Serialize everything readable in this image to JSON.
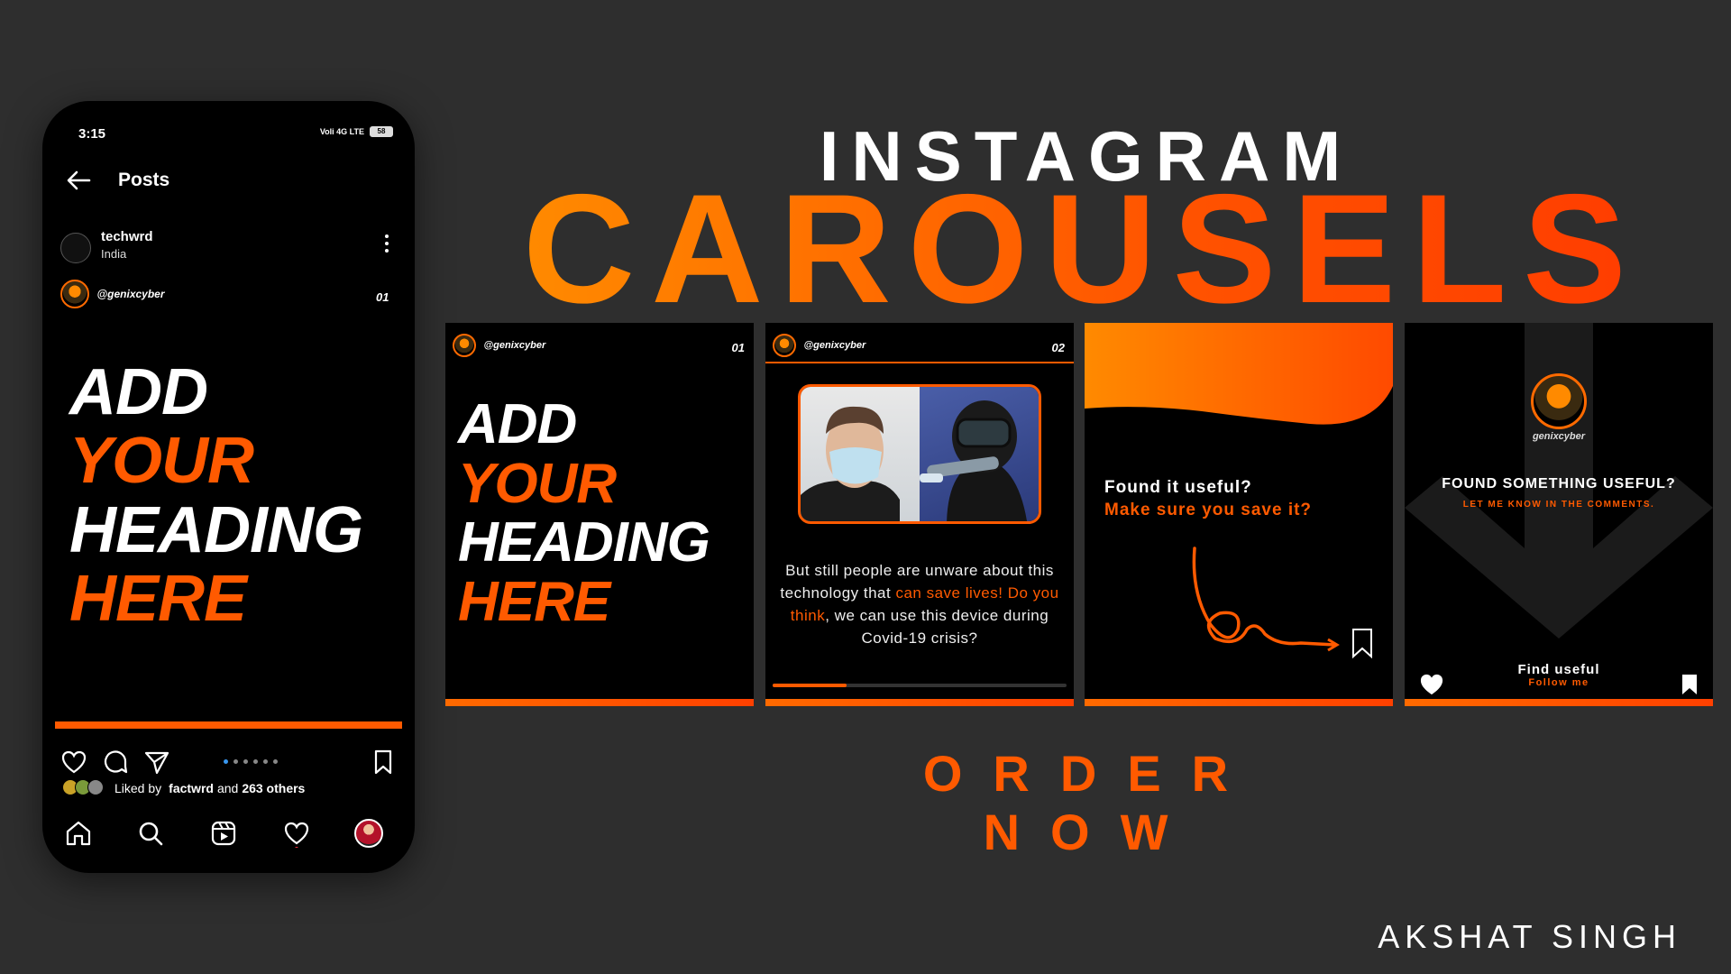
{
  "phone": {
    "time": "3:15",
    "network": "Voli 4G LTE",
    "battery": "58",
    "screen_title": "Posts",
    "post_user": "techwrd",
    "post_location": "India",
    "handle": "@genixcyber",
    "page": "01",
    "heading": [
      "ADD",
      "YOUR",
      "HEADING",
      "HERE"
    ],
    "liked_prefix": "Liked by",
    "liked_user": "factwrd",
    "liked_and": "and",
    "liked_others": "263 others"
  },
  "title": {
    "line1": "INSTAGRAM",
    "line2": "CAROUSELS"
  },
  "cards": {
    "card1": {
      "handle": "@genixcyber",
      "page": "01",
      "heading": [
        "ADD",
        "YOUR",
        "HEADING",
        "HERE"
      ]
    },
    "card2": {
      "handle": "@genixcyber",
      "page": "02",
      "text_1": "But still people are unware about this technology that",
      "text_highlight_1": "can save lives!",
      "text_highlight_2": "Do you think",
      "text_2": ", we can use this device during Covid-19 crisis?",
      "progress": 0.25
    },
    "card3": {
      "line1": "Found it useful?",
      "line2": "Make sure you save it?"
    },
    "card4": {
      "handle": "genixcyber",
      "title": "FOUND SOMETHING USEFUL?",
      "subtitle": "LET ME KNOW IN THE COMMENTS.",
      "find": "Find useful",
      "follow": "Follow me"
    }
  },
  "cta": "ORDER NOW",
  "author": "AKSHAT SINGH",
  "colors": {
    "accent": "#ff5a00",
    "background": "#2e2e2e"
  }
}
